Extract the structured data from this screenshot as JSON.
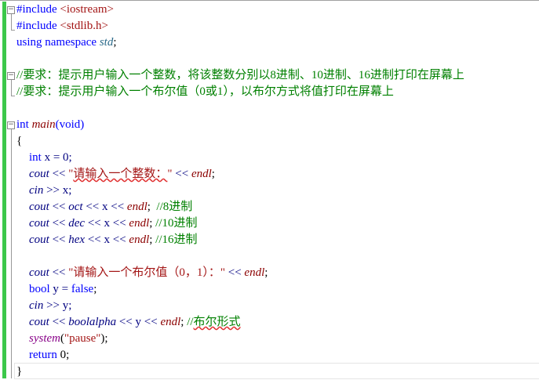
{
  "editor": {
    "lines": [
      {
        "indent": false,
        "fold": "minus",
        "tokens": [
          {
            "t": "#include ",
            "c": "kw"
          },
          {
            "t": "<iostream>",
            "c": "str"
          }
        ]
      },
      {
        "indent": false,
        "tokens": [
          {
            "t": "#include ",
            "c": "kw"
          },
          {
            "t": "<stdlib.h>",
            "c": "str"
          }
        ]
      },
      {
        "indent": false,
        "tokens": [
          {
            "t": "using namespace ",
            "c": "kw"
          },
          {
            "t": "std",
            "c": "ns"
          },
          {
            "t": ";",
            "c": "pl"
          }
        ]
      },
      {
        "indent": false,
        "tokens": []
      },
      {
        "indent": false,
        "fold": "minus",
        "tokens": [
          {
            "t": "//要求：提示用户输入一个整数，将该整数分别以8进制、10进制、16进制打印在屏幕上",
            "c": "cm"
          }
        ]
      },
      {
        "indent": false,
        "tokens": [
          {
            "t": "//要求：提示用户输入一个布尔值（0或1），以布尔方式将值打印在屏幕上",
            "c": "cm"
          }
        ]
      },
      {
        "indent": false,
        "tokens": []
      },
      {
        "indent": false,
        "fold": "minus",
        "tokens": [
          {
            "t": "int ",
            "c": "kw"
          },
          {
            "t": "main",
            "c": "fn"
          },
          {
            "t": "(void)",
            "c": "kw"
          }
        ]
      },
      {
        "indent": false,
        "tokens": [
          {
            "t": "{",
            "c": "pl"
          }
        ]
      },
      {
        "indent": true,
        "tokens": [
          {
            "t": "int ",
            "c": "kw"
          },
          {
            "t": "x = 0;",
            "c": "id"
          }
        ]
      },
      {
        "indent": true,
        "tokens": [
          {
            "t": "cout",
            "c": "idi"
          },
          {
            "t": " << ",
            "c": "id"
          },
          {
            "t": "\"",
            "c": "str"
          },
          {
            "t": "请输入一个整数：",
            "c": "str sq"
          },
          {
            "t": "\"",
            "c": "str"
          },
          {
            "t": " << ",
            "c": "id"
          },
          {
            "t": "endl",
            "c": "fn"
          },
          {
            "t": ";",
            "c": "pl"
          }
        ]
      },
      {
        "indent": true,
        "tokens": [
          {
            "t": "cin",
            "c": "idi"
          },
          {
            "t": " >> x;",
            "c": "id"
          }
        ]
      },
      {
        "indent": true,
        "tokens": [
          {
            "t": "cout",
            "c": "idi"
          },
          {
            "t": " << ",
            "c": "id"
          },
          {
            "t": "oct",
            "c": "idi"
          },
          {
            "t": " << x << ",
            "c": "id"
          },
          {
            "t": "endl",
            "c": "fn"
          },
          {
            "t": ";  ",
            "c": "pl"
          },
          {
            "t": "//8进制",
            "c": "cm"
          }
        ]
      },
      {
        "indent": true,
        "tokens": [
          {
            "t": "cout",
            "c": "idi"
          },
          {
            "t": " << ",
            "c": "id"
          },
          {
            "t": "dec",
            "c": "idi"
          },
          {
            "t": " << x << ",
            "c": "id"
          },
          {
            "t": "endl",
            "c": "fn"
          },
          {
            "t": "; ",
            "c": "pl"
          },
          {
            "t": "//10进制",
            "c": "cm"
          }
        ]
      },
      {
        "indent": true,
        "tokens": [
          {
            "t": "cout",
            "c": "idi"
          },
          {
            "t": " << ",
            "c": "id"
          },
          {
            "t": "hex",
            "c": "idi"
          },
          {
            "t": " << x << ",
            "c": "id"
          },
          {
            "t": "endl",
            "c": "fn"
          },
          {
            "t": "; ",
            "c": "pl"
          },
          {
            "t": "//16进制",
            "c": "cm"
          }
        ]
      },
      {
        "indent": true,
        "tokens": []
      },
      {
        "indent": true,
        "tokens": [
          {
            "t": "cout",
            "c": "idi"
          },
          {
            "t": " << ",
            "c": "id"
          },
          {
            "t": "\"请输入一个布尔值（0，1）：\"",
            "c": "str"
          },
          {
            "t": " << ",
            "c": "id"
          },
          {
            "t": "endl",
            "c": "fn"
          },
          {
            "t": ";",
            "c": "pl"
          }
        ]
      },
      {
        "indent": true,
        "tokens": [
          {
            "t": "bool ",
            "c": "kw"
          },
          {
            "t": "y = ",
            "c": "id"
          },
          {
            "t": "false",
            "c": "kw"
          },
          {
            "t": ";",
            "c": "pl"
          }
        ]
      },
      {
        "indent": true,
        "tokens": [
          {
            "t": "cin",
            "c": "idi"
          },
          {
            "t": " >> y;",
            "c": "id"
          }
        ]
      },
      {
        "indent": true,
        "tokens": [
          {
            "t": "cout",
            "c": "idi"
          },
          {
            "t": " << ",
            "c": "id"
          },
          {
            "t": "boolalpha",
            "c": "idi"
          },
          {
            "t": " << y << ",
            "c": "id"
          },
          {
            "t": "endl",
            "c": "fn"
          },
          {
            "t": "; ",
            "c": "pl"
          },
          {
            "t": "//",
            "c": "cm"
          },
          {
            "t": "布尔形式",
            "c": "cm sq"
          }
        ]
      },
      {
        "indent": true,
        "tokens": [
          {
            "t": "system",
            "c": "sys"
          },
          {
            "t": "(",
            "c": "pl"
          },
          {
            "t": "\"pause\"",
            "c": "str"
          },
          {
            "t": ");",
            "c": "pl"
          }
        ]
      },
      {
        "indent": true,
        "tokens": [
          {
            "t": "return ",
            "c": "kw"
          },
          {
            "t": "0;",
            "c": "pl"
          }
        ]
      },
      {
        "indent": false,
        "tokens": [
          {
            "t": "}",
            "c": "pl"
          }
        ]
      }
    ],
    "fold_minus_glyph": "−"
  }
}
